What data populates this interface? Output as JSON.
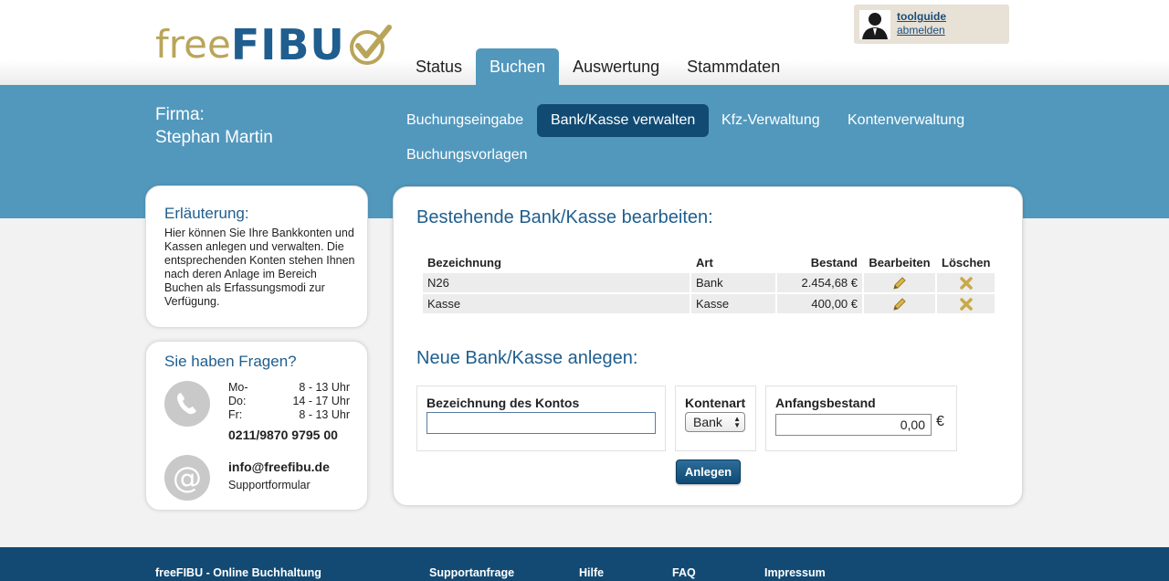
{
  "header": {
    "logo": {
      "free": "free",
      "fibu": "FIBU"
    },
    "user": {
      "name": "toolguide",
      "logout": "abmelden"
    },
    "tabs": [
      {
        "label": "Status",
        "active": false
      },
      {
        "label": "Buchen",
        "active": true
      },
      {
        "label": "Auswertung",
        "active": false
      },
      {
        "label": "Stammdaten",
        "active": false
      }
    ]
  },
  "band": {
    "firma_label": "Firma:",
    "firma_name": "Stephan Martin",
    "subnav": [
      {
        "label": "Buchungseingabe",
        "active": false
      },
      {
        "label": "Bank/Kasse verwalten",
        "active": true
      },
      {
        "label": "Kfz-Verwaltung",
        "active": false
      },
      {
        "label": "Kontenverwaltung",
        "active": false
      },
      {
        "label": "Buchungsvorlagen",
        "active": false
      }
    ]
  },
  "info": {
    "title": "Erläuterung:",
    "text": "Hier können Sie Ihre Bankkonten und Kassen anlegen und verwalten. Die entsprechenden Konten stehen Ihnen nach deren Anlage im Bereich Buchen als Erfassungsmodi zur Verfügung."
  },
  "help": {
    "title": "Sie haben Fragen?",
    "hours": [
      {
        "day": "Mo-",
        "time": "8 - 13 Uhr"
      },
      {
        "day": "Do:",
        "time": "14 - 17 Uhr"
      },
      {
        "day": "Fr:",
        "time": "8 - 13 Uhr"
      }
    ],
    "phone": "0211/9870 9795 00",
    "email": "info@freefibu.de",
    "support": "Supportformular"
  },
  "panel": {
    "edit_title": "Bestehende Bank/Kasse bearbeiten:",
    "columns": [
      "Bezeichnung",
      "Art",
      "Bestand",
      "Bearbeiten",
      "Löschen"
    ],
    "rows": [
      {
        "name": "N26",
        "art": "Bank",
        "bestand": "2.454,68 €"
      },
      {
        "name": "Kasse",
        "art": "Kasse",
        "bestand": "400,00 €"
      }
    ],
    "new_title": "Neue Bank/Kasse anlegen:",
    "form": {
      "name_label": "Bezeichnung des Kontos",
      "name_value": "",
      "art_label": "Kontenart",
      "art_value": "Bank",
      "start_label": "Anfangsbestand",
      "start_value": "0,00",
      "currency": "€",
      "submit": "Anlegen"
    }
  },
  "footer": {
    "brand": "freeFIBU - Online Buchhaltung",
    "links": [
      "Supportanfrage",
      "Hilfe",
      "FAQ",
      "Impressum"
    ]
  },
  "colors": {
    "brand_blue": "#5298bd",
    "dark_blue": "#114b73",
    "logo_gold": "#b9a55a",
    "logo_blue": "#1f5e8e"
  }
}
